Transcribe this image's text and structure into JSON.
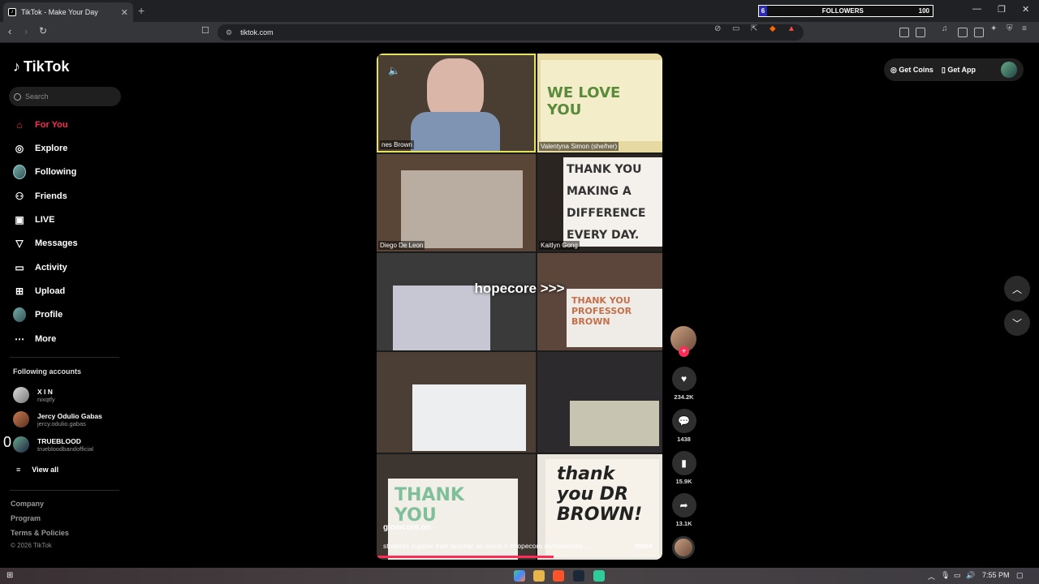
{
  "browser": {
    "tab_title": "TikTok - Make Your Day",
    "new_tab": "+",
    "url": "tiktok.com",
    "followers_widget": {
      "count": "6",
      "label": "FOLLOWERS",
      "max": "100"
    }
  },
  "sidebar": {
    "logo": "TikTok",
    "search_placeholder": "Search",
    "items": [
      {
        "label": "For You",
        "icon": "home-icon"
      },
      {
        "label": "Explore",
        "icon": "compass-icon"
      },
      {
        "label": "Following",
        "icon": "avatar-icon"
      },
      {
        "label": "Friends",
        "icon": "friends-icon"
      },
      {
        "label": "LIVE",
        "icon": "live-icon"
      },
      {
        "label": "Messages",
        "icon": "send-icon"
      },
      {
        "label": "Activity",
        "icon": "activity-icon"
      },
      {
        "label": "Upload",
        "icon": "plus-square-icon"
      },
      {
        "label": "Profile",
        "icon": "profile-icon"
      },
      {
        "label": "More",
        "icon": "ellipsis-icon"
      }
    ],
    "following_title": "Following accounts",
    "accounts": [
      {
        "name": "X I N",
        "handle": "nixqtfy"
      },
      {
        "name": "Jercy Odulio Gabas",
        "handle": "jercy.odulio.gabas"
      },
      {
        "name": "TRUEBLOOD",
        "handle": "truebloodbandofficial"
      }
    ],
    "view_all": "View all",
    "footer": [
      "Company",
      "Program",
      "Terms & Policies"
    ],
    "copyright": "© 2026 TikTok",
    "glitch_text": "0"
  },
  "video": {
    "overlay_caption": "hopecore >>>",
    "participants": [
      "nes Brown",
      "Valentyna Simon (she/her)",
      "Diego De Leon",
      "Kaitlyn Gong"
    ],
    "signs": [
      "THANK YOU MAKING A DIFFERENCE EVERY DAY.",
      "WE LOVE YOU",
      "Thank you",
      "THANK YOU PROFESSOR BROWN",
      "thank you DR BROWN!",
      "THANK YOU"
    ],
    "username": "glowcore.on",
    "description": "students suprise their teacher on zoom // #hopecore #wholesome ...",
    "more": "more",
    "progress": 0.62
  },
  "actions": {
    "likes": "234.2K",
    "comments": "1438",
    "saves": "15.9K",
    "shares": "13.1K"
  },
  "topbar": {
    "get_coins": "Get Coins",
    "get_app": "Get App"
  },
  "taskbar": {
    "time": "7:55 PM"
  }
}
